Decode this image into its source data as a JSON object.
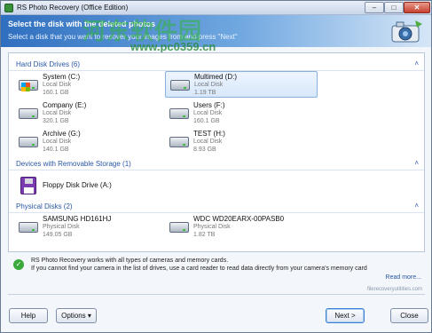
{
  "window": {
    "title": "RS Photo Recovery (Office Edition)",
    "min": "–",
    "max": "□",
    "close": "✕"
  },
  "header": {
    "title": "Select the disk with the deleted photos",
    "subtitle": "Select a disk that you want to recover your images from and press \"Next\""
  },
  "watermark": {
    "brand": "河东软件园",
    "site": "www.pc0359.cn"
  },
  "sections": {
    "hdd": "Hard Disk Drives (6)",
    "removable": "Devices with Removable Storage (1)",
    "physical": "Physical Disks (2)",
    "chevron": "˄"
  },
  "drives": [
    {
      "name": "System (C:)",
      "type": "Local Disk",
      "size": "160.1 GB"
    },
    {
      "name": "Multimed (D:)",
      "type": "Local Disk",
      "size": "1.19 TB"
    },
    {
      "name": "Company (E:)",
      "type": "Local Disk",
      "size": "320.1 GB"
    },
    {
      "name": "Users (F:)",
      "type": "Local Disk",
      "size": "160.1 GB"
    },
    {
      "name": "Archive (G:)",
      "type": "Local Disk",
      "size": "140.1 GB"
    },
    {
      "name": "TEST (H:)",
      "type": "Local Disk",
      "size": "8.93 GB"
    }
  ],
  "removable": [
    {
      "name": "Floppy Disk Drive (A:)"
    }
  ],
  "physical": [
    {
      "name": "SAMSUNG HD161HJ",
      "type": "Physical Disk",
      "size": "149.05 GB"
    },
    {
      "name": "WDC WD20EARX-00PASB0",
      "type": "Physical Disk",
      "size": "1.82 TB"
    }
  ],
  "info": {
    "line1": "RS Photo Recovery works with all types of cameras and memory cards.",
    "line2": "If you cannot find your camera in the list of drives, use a card reader to read data directly from your camera's memory card",
    "more": "Read more...",
    "ok_icon": "✓"
  },
  "footer_site": "filerecoveryutilities.com",
  "buttons": {
    "help": "Help",
    "options": "Options ▾",
    "next": "Next >",
    "close": "Close"
  }
}
